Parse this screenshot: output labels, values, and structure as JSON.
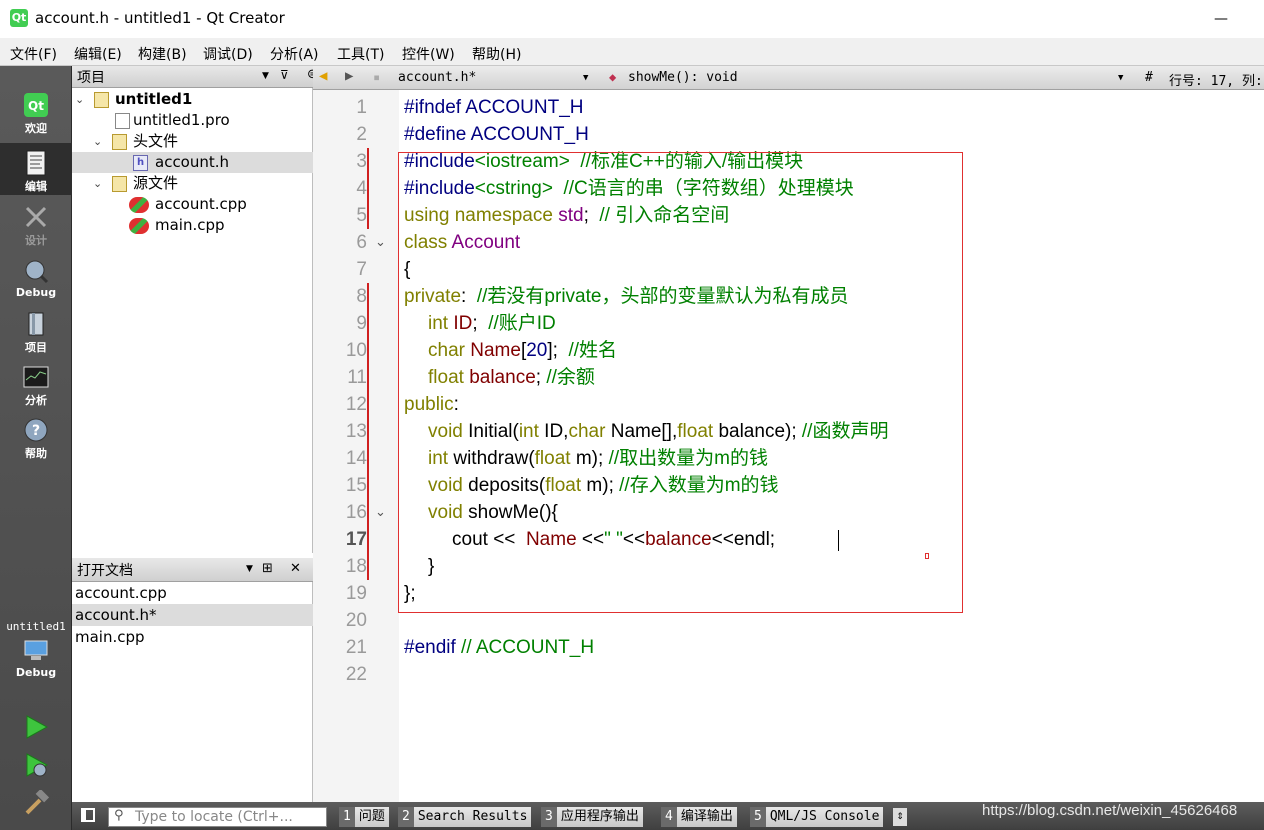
{
  "window": {
    "title": "account.h - untitled1 - Qt Creator",
    "app_icon": "Qt",
    "min": "—"
  },
  "menu": [
    "文件(F)",
    "编辑(E)",
    "构建(B)",
    "调试(D)",
    "分析(A)",
    "工具(T)",
    "控件(W)",
    "帮助(H)"
  ],
  "modes": {
    "welcome": "欢迎",
    "edit": "编辑",
    "design": "设计",
    "debug": "Debug",
    "projects": "项目",
    "analyze": "分析",
    "help": "帮助"
  },
  "kit": {
    "project": "untitled1",
    "config": "Debug"
  },
  "project_panel": {
    "title": "项目",
    "tree": {
      "root": "untitled1",
      "pro": "untitled1.pro",
      "headers": "头文件",
      "header_file": "account.h",
      "sources": "源文件",
      "src1": "account.cpp",
      "src2": "main.cpp"
    }
  },
  "open_docs": {
    "title": "打开文档",
    "items": [
      "account.cpp",
      "account.h*",
      "main.cpp"
    ]
  },
  "editor_toolbar": {
    "file": "account.h*",
    "symbol": "showMe(): void",
    "hash": "#",
    "position": "行号: 17, 列:"
  },
  "line_numbers": [
    "1",
    "2",
    "3",
    "4",
    "5",
    "6",
    "7",
    "8",
    "9",
    "10",
    "11",
    "12",
    "13",
    "14",
    "15",
    "16",
    "17",
    "18",
    "19",
    "20",
    "21",
    "22"
  ],
  "code": {
    "l1a": "#ifndef",
    "l1b": " ACCOUNT_H",
    "l2a": "#define",
    "l2b": " ACCOUNT_H",
    "l3a": "#include",
    "l3b": "<iostream>",
    "l3c": "  //标准C++的输入/输出模块",
    "l4a": "#include",
    "l4b": "<cstring>",
    "l4c": "  //C语言的串（字符数组）处理模块",
    "l5a": "using namespace",
    "l5b": " std",
    "l5c": ";  ",
    "l5d": "// 引入命名空间",
    "l6a": "class",
    "l6b": " Account",
    "l7": "{",
    "l8a": "private",
    "l8b": ":  ",
    "l8c": "//若没有private，头部的变量默认为私有成员",
    "l9a": "int",
    "l9b": " ID",
    "l9c": ";  ",
    "l9d": "//账户ID",
    "l10a": "char",
    "l10b": " Name",
    "l10c": "[",
    "l10d": "20",
    "l10e": "];  ",
    "l10f": "//姓名",
    "l11a": "float",
    "l11b": " balance",
    "l11c": "; ",
    "l11d": "//余额",
    "l12a": "public",
    "l12b": ":",
    "l13a": "void",
    "l13b": " Initial(",
    "l13c": "int",
    "l13d": " ID,",
    "l13e": "char",
    "l13f": " Name[],",
    "l13g": "float",
    "l13h": " balance); ",
    "l13i": "//函数声明",
    "l14a": "int",
    "l14b": " withdraw(",
    "l14c": "float",
    "l14d": " m); ",
    "l14e": "//取出数量为m的钱",
    "l15a": "void",
    "l15b": " deposits(",
    "l15c": "float",
    "l15d": " m); ",
    "l15e": "//存入数量为m的钱",
    "l16a": "void",
    "l16b": " showMe(){",
    "l17a": "cout << ",
    "l17b": " Name",
    "l17c": " <<",
    "l17d": "\" \"",
    "l17e": "<<",
    "l17f": "balance",
    "l17g": "<<endl;",
    "l18": "}",
    "l19": "};",
    "l21a": "#endif",
    "l21b": " // ACCOUNT_H"
  },
  "bottom": {
    "locate_placeholder": "Type to locate (Ctrl+...",
    "tabs": [
      {
        "n": "1",
        "t": "问题"
      },
      {
        "n": "2",
        "t": "Search Results"
      },
      {
        "n": "3",
        "t": "应用程序输出"
      },
      {
        "n": "4",
        "t": "编译输出"
      },
      {
        "n": "5",
        "t": "QML/JS Console"
      }
    ],
    "watermark": "https://blog.csdn.net/weixin_45626468"
  }
}
